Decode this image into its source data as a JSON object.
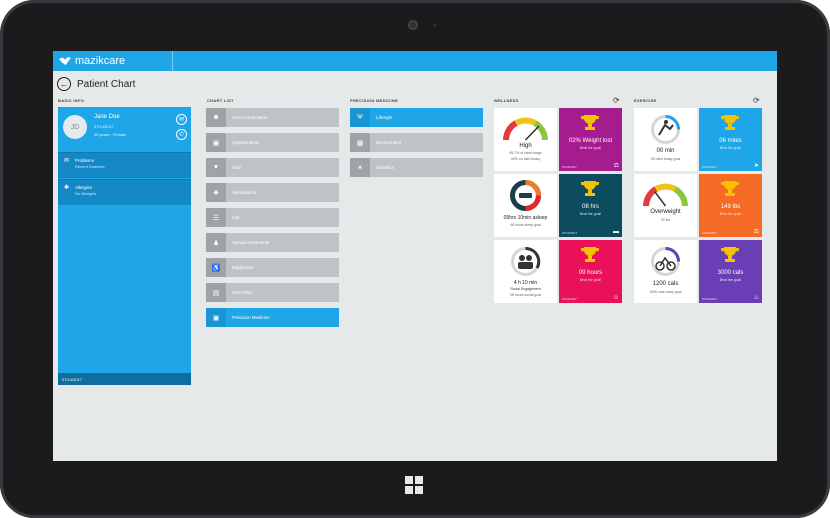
{
  "app": {
    "brand": "mazikcare",
    "page_title": "Patient Chart"
  },
  "sections": {
    "patient_card": "BASIC INFO",
    "chart_list": "CHART LIST",
    "precision_medicine": "PRECISION MEDICINE",
    "wellness": "WELLNESS",
    "exercise": "EXERCISE"
  },
  "patient": {
    "initials": "JD",
    "name": "Jane Doe",
    "line1": "07/14/2017",
    "line2": "45 years · Female",
    "rows": [
      {
        "title": "Problems",
        "subtitle": "Recent Diabetes"
      },
      {
        "title": "Allergies",
        "subtitle": "No Allergies"
      }
    ],
    "footer": "07/14/2017"
  },
  "chart_list": [
    {
      "icon": "group-icon",
      "label": "Care coordination"
    },
    {
      "icon": "folder-icon",
      "label": "Appointments"
    },
    {
      "icon": "heart-icon",
      "label": "Vital"
    },
    {
      "icon": "pills-icon",
      "label": "Medications"
    },
    {
      "icon": "lab-icon",
      "label": "Lab"
    },
    {
      "icon": "person-icon",
      "label": "Special treatments"
    },
    {
      "icon": "wheelchair-icon",
      "label": "Equipment"
    },
    {
      "icon": "book-icon",
      "label": "Care Plan"
    },
    {
      "icon": "folder-icon",
      "label": "Precision Medicine",
      "active": true
    }
  ],
  "precision_medicine": [
    {
      "icon": "lifestyle-icon",
      "label": "Lifestyle",
      "active": true
    },
    {
      "icon": "environment-icon",
      "label": "Environment"
    },
    {
      "icon": "genetics-icon",
      "label": "Genetics"
    }
  ],
  "wellness": {
    "tiles": [
      {
        "kind": "gauge",
        "value": "High",
        "sub1": "65.7% of ideal range",
        "sub2": "43% on alert today"
      },
      {
        "kind": "trophy",
        "bg": "#a41c8e",
        "value": "02% Weight lost",
        "sub": "Beat the goal!",
        "date": "07/11/2017",
        "corner_icon": "scale-icon"
      },
      {
        "kind": "ring",
        "value": "05hrs 10min asleep",
        "sub": "08 hours sleep goal"
      },
      {
        "kind": "trophy",
        "bg": "#0d4b5e",
        "value": "08 hrs",
        "sub": "Beat the goal!",
        "date": "07/13/2017",
        "corner_icon": "bed-icon"
      },
      {
        "kind": "ring",
        "value": "4 h 10 min",
        "sub1": "Social Engagement",
        "sub2": "06 hours social goal"
      },
      {
        "kind": "trophy",
        "bg": "#e8115a",
        "value": "09 hours",
        "sub": "Beat the goal!",
        "date": "07/11/2017",
        "corner_icon": "people-icon"
      }
    ]
  },
  "exercise": {
    "tiles": [
      {
        "kind": "ring",
        "value": "00 min",
        "sub": "30 mins today goal"
      },
      {
        "kind": "trophy",
        "bg": "#1ea6e8",
        "value": "06 miles",
        "sub": "Beat the goal!",
        "date": "07/12/2017",
        "corner_icon": "runner-icon"
      },
      {
        "kind": "gauge",
        "value": "Overweight",
        "sub1": "30 lbs",
        "sub2": ""
      },
      {
        "kind": "trophy",
        "bg": "#f56a25",
        "value": "149 lbs",
        "sub": "Beat the goal!",
        "date": "07/12/2017",
        "corner_icon": "weight-icon"
      },
      {
        "kind": "ring",
        "value": "1200 cals",
        "sub": "2000 cals today goal"
      },
      {
        "kind": "trophy",
        "bg": "#6a3fb5",
        "value": "3000 cals",
        "sub": "Beat the goal!",
        "date": "07/13/2017",
        "corner_icon": "flame-icon"
      }
    ]
  },
  "colors": {
    "accent": "#1ea6e8",
    "accent_dark": "#1488c4",
    "menu_grey": "#bfc3c5",
    "trophy": "#f5c200"
  }
}
